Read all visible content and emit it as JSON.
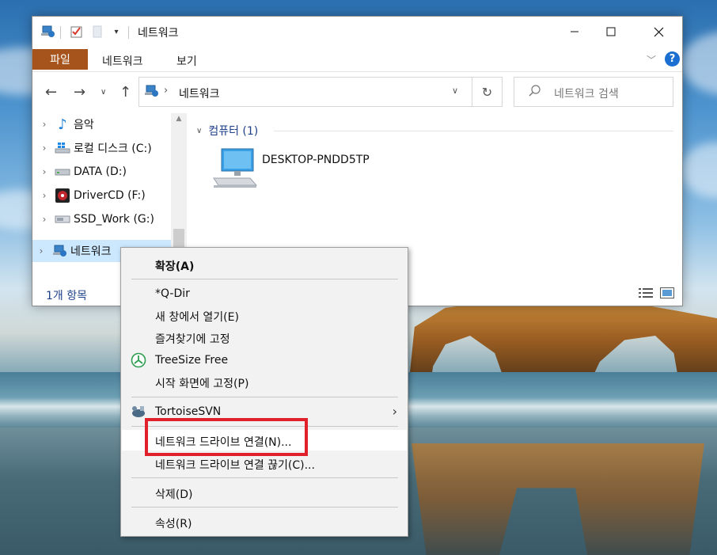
{
  "window": {
    "title": "네트워크",
    "ribbon_tabs": {
      "file": "파일",
      "network": "네트워크",
      "view": "보기"
    },
    "address_path": "네트워크",
    "search_placeholder": "네트워크 검색"
  },
  "sidebar": {
    "items": [
      {
        "label": "음악",
        "icon": "music-icon"
      },
      {
        "label": "로컬 디스크 (C:)",
        "icon": "windows-drive-icon"
      },
      {
        "label": "DATA (D:)",
        "icon": "drive-icon"
      },
      {
        "label": "DriverCD (F:)",
        "icon": "disc-drive-icon"
      },
      {
        "label": "SSD_Work (G:)",
        "icon": "ssd-icon"
      },
      {
        "label": "네트워크",
        "icon": "network-icon",
        "selected": true
      }
    ]
  },
  "content": {
    "group_header": "컴퓨터 (1)",
    "items": [
      {
        "label": "DESKTOP-PNDD5TP",
        "icon": "computer-icon"
      }
    ]
  },
  "status": {
    "item_count": "1개 항목"
  },
  "context_menu": {
    "expand": "확장(A)",
    "qdir": "*Q-Dir",
    "open_new_window": "새 창에서 열기(E)",
    "pin_quick_access": "즐겨찾기에 고정",
    "treesize": "TreeSize Free",
    "pin_start": "시작 화면에 고정(P)",
    "tortoisesvn": "TortoiseSVN",
    "map_drive": "네트워크 드라이브 연결(N)...",
    "disconnect_drive": "네트워크 드라이브 연결 끊기(C)...",
    "delete": "삭제(D)",
    "properties": "속성(R)"
  },
  "colors": {
    "file_tab": "#a6541b",
    "selection": "#cce8ff",
    "highlight_box": "#e0202a",
    "accent_blue": "#1e3f8a"
  }
}
